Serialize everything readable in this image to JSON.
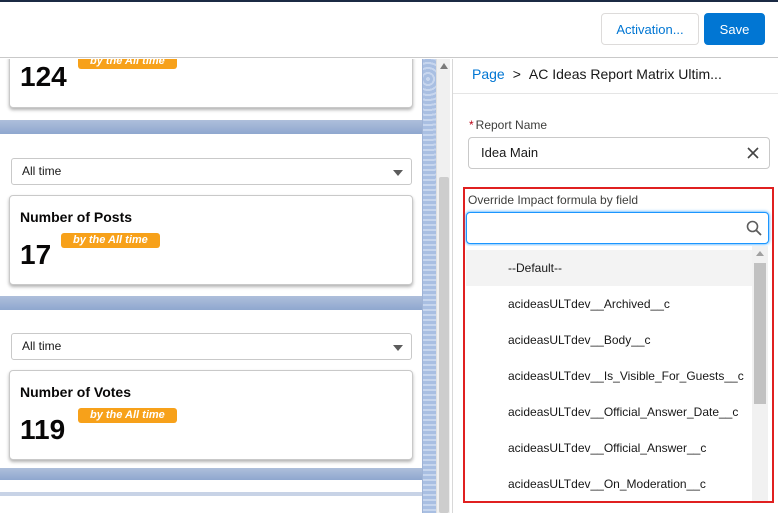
{
  "header": {
    "activation_label": "Activation...",
    "save_label": "Save"
  },
  "canvas": {
    "cards": [
      {
        "value": "124",
        "badge": "by the All time"
      },
      {
        "title": "Number of Posts",
        "value": "17",
        "badge": "by the All time"
      },
      {
        "title": "Number of Votes",
        "value": "119",
        "badge": "by the All time"
      }
    ],
    "filters": [
      {
        "value": "All time"
      },
      {
        "value": "All time"
      }
    ]
  },
  "panel": {
    "breadcrumb": {
      "root": "Page",
      "separator": ">",
      "current": "AC Ideas Report Matrix Ultim..."
    },
    "report_name": {
      "required_mark": "*",
      "label": "Report Name",
      "value": "Idea Main"
    },
    "override": {
      "label": "Override Impact formula by field",
      "search_value": "",
      "options": [
        "--Default--",
        "acideasULTdev__Archived__c",
        "acideasULTdev__Body__c",
        "acideasULTdev__Is_Visible_For_Guests__c",
        "acideasULTdev__Official_Answer_Date__c",
        "acideasULTdev__Official_Answer__c",
        "acideasULTdev__On_Moderation__c"
      ]
    }
  },
  "colors": {
    "brand": "#0176d3",
    "badge": "#f7a11a",
    "highlight": "#e02020"
  }
}
